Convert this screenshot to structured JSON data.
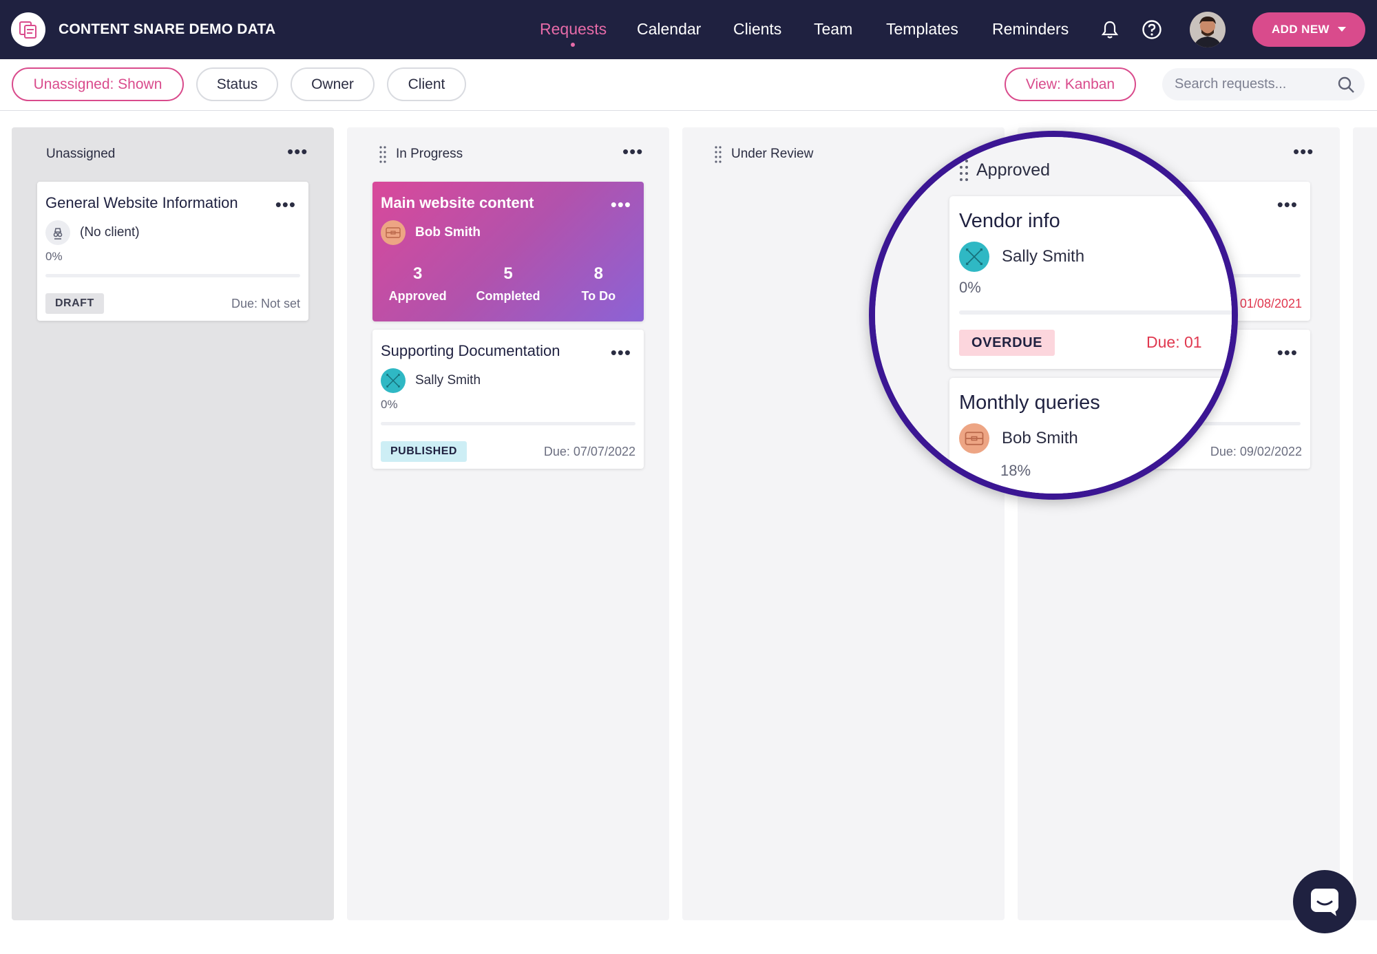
{
  "app": {
    "title": "CONTENT SNARE DEMO DATA"
  },
  "nav": {
    "items": [
      {
        "label": "Requests",
        "active": true
      },
      {
        "label": "Calendar"
      },
      {
        "label": "Clients"
      },
      {
        "label": "Team"
      },
      {
        "label": "Templates"
      },
      {
        "label": "Reminders"
      }
    ],
    "icons": [
      "bell-icon",
      "help-circle-icon"
    ],
    "add_new_label": "ADD NEW"
  },
  "filters": {
    "unassigned": "Unassigned: Shown",
    "status": "Status",
    "owner": "Owner",
    "client": "Client",
    "view": "View: Kanban",
    "search_placeholder": "Search requests..."
  },
  "columns": [
    {
      "title": "Unassigned",
      "cards": [
        {
          "title": "General Website Information",
          "owner": "(No client)",
          "progress": "0%",
          "badge": "DRAFT",
          "due": "Due: Not set"
        }
      ]
    },
    {
      "title": "In Progress",
      "cards": [
        {
          "title": "Main website content",
          "owner": "Bob Smith",
          "stats": [
            {
              "n": "3",
              "l": "Approved"
            },
            {
              "n": "5",
              "l": "Completed"
            },
            {
              "n": "8",
              "l": "To Do"
            }
          ]
        },
        {
          "title": "Supporting Documentation",
          "owner": "Sally Smith",
          "progress": "0%",
          "badge": "PUBLISHED",
          "due": "Due: 07/07/2022"
        }
      ]
    },
    {
      "title": "Under Review",
      "cards": []
    },
    {
      "title": "Approved",
      "cards": [
        {
          "title": "Vendor info",
          "owner": "Sally Smith",
          "progress": "0%",
          "badge": "OVERDUE",
          "due_partial": "Due: 01",
          "due_edge": "01/08/2021"
        },
        {
          "title": "Monthly queries",
          "owner": "Bob Smith",
          "progress": "18%",
          "due": "Due: 09/02/2022"
        }
      ]
    }
  ],
  "colors": {
    "nav_bg": "#1f2140",
    "accent": "#d94b8c",
    "magnifier_ring": "#3b1693",
    "overdue": "#e0384f"
  }
}
